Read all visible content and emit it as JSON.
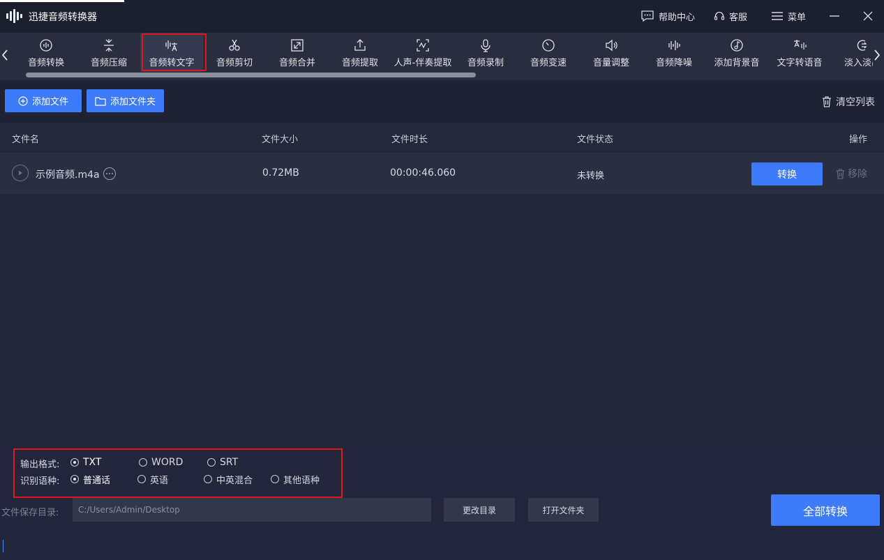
{
  "app": {
    "title": "迅捷音频转换器"
  },
  "titlebar": {
    "help": "帮助中心",
    "service": "客服",
    "menu": "菜单"
  },
  "toolbar": {
    "items": [
      {
        "label": "音频转换",
        "icon": "music-disc-icon"
      },
      {
        "label": "音频压缩",
        "icon": "compress-icon"
      },
      {
        "label": "音频转文字",
        "icon": "audio-to-text-icon"
      },
      {
        "label": "音频剪切",
        "icon": "scissors-icon"
      },
      {
        "label": "音频合并",
        "icon": "merge-icon"
      },
      {
        "label": "音频提取",
        "icon": "extract-icon"
      },
      {
        "label": "人声-伴奏提取",
        "icon": "vocal-extract-icon"
      },
      {
        "label": "音频录制",
        "icon": "microphone-icon"
      },
      {
        "label": "音频变速",
        "icon": "speed-dial-icon"
      },
      {
        "label": "音量调整",
        "icon": "volume-icon"
      },
      {
        "label": "音频降噪",
        "icon": "denoise-icon"
      },
      {
        "label": "添加背景音",
        "icon": "background-music-icon"
      },
      {
        "label": "文字转语音",
        "icon": "text-to-speech-icon"
      },
      {
        "label": "淡入淡出",
        "icon": "fade-icon"
      }
    ],
    "active_index": 2
  },
  "actions": {
    "add_file": "添加文件",
    "add_folder": "添加文件夹",
    "clear_list": "清空列表"
  },
  "table": {
    "headers": {
      "name": "文件名",
      "size": "文件大小",
      "duration": "文件时长",
      "status": "文件状态",
      "ops": "操作"
    },
    "rows": [
      {
        "name": "示例音频.m4a",
        "size": "0.72MB",
        "duration": "00:00:46.060",
        "status": "未转换",
        "convert": "转换",
        "remove": "移除"
      }
    ]
  },
  "options": {
    "format_label": "输出格式:",
    "formats": [
      "TXT",
      "WORD",
      "SRT"
    ],
    "format_selected": "TXT",
    "language_label": "识别语种:",
    "languages": [
      "普通话",
      "英语",
      "中英混合",
      "其他语种"
    ],
    "language_selected": "普通话"
  },
  "save": {
    "label": "文件保存目录:",
    "path": "C:/Users/Admin/Desktop",
    "change_dir": "更改目录",
    "open_folder": "打开文件夹",
    "convert_all": "全部转换"
  },
  "colors": {
    "accent": "#3e7bfa",
    "highlight": "#e0161c",
    "background": "#1f2233"
  }
}
